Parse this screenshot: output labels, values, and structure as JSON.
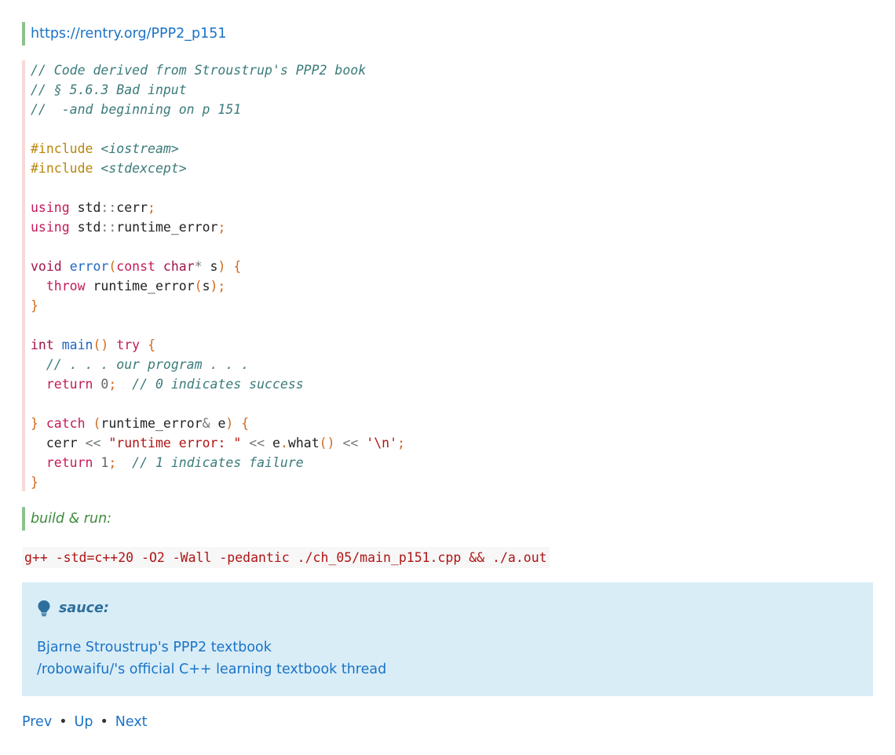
{
  "top_link": {
    "text": "https://rentry.org/PPP2_p151"
  },
  "code": {
    "comments": {
      "line1": "// Code derived from Stroustrup's PPP2 book",
      "line2": "// § 5.6.3 Bad input",
      "line3": "//  -and beginning on p 151"
    },
    "includes": [
      {
        "directive": "#include",
        "header": "<iostream>"
      },
      {
        "directive": "#include",
        "header": "<stdexcept>"
      }
    ],
    "usings": [
      {
        "kw": "using",
        "ns": "std",
        "name": "cerr"
      },
      {
        "kw": "using",
        "ns": "std",
        "name": "runtime_error"
      }
    ],
    "error_fn": {
      "ret_type": "void",
      "name": "error",
      "const_kw": "const",
      "char_kw": "char",
      "param": "s",
      "throw_kw": "throw",
      "throw_type": "runtime_error",
      "throw_arg": "s"
    },
    "main_fn": {
      "ret_type": "int",
      "name": "main",
      "try_kw": "try",
      "body_comment": "// . . . our program . . .",
      "return_kw": "return",
      "return_val0": "0",
      "success_comment": "// 0 indicates success",
      "catch_kw": "catch",
      "catch_type": "runtime_error",
      "catch_var": "e",
      "cerr": "cerr",
      "err_str": "\"runtime error: \"",
      "e_var": "e",
      "what": "what",
      "newline_char": "'\\n'",
      "return_val1": "1",
      "failure_comment": "// 1 indicates failure"
    }
  },
  "build": {
    "label": "build & run:",
    "command": "g++ -std=c++20 -O2 -Wall -pedantic ./ch_05/main_p151.cpp && ./a.out"
  },
  "note": {
    "icon": "lightbulb-icon",
    "title": "sauce:",
    "links": [
      "Bjarne Stroustrup's PPP2 textbook",
      "/robowaifu/'s official C++ learning textbook thread"
    ]
  },
  "nav": {
    "prev": "Prev",
    "up": "Up",
    "next": "Next",
    "separator": "•"
  }
}
